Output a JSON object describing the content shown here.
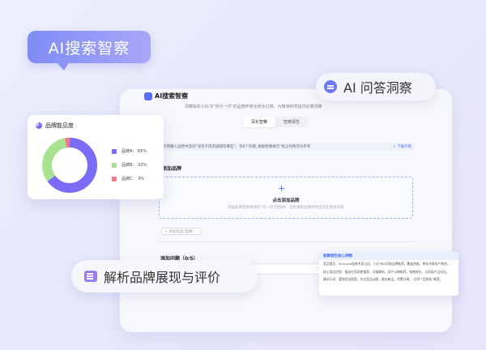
{
  "badge_title": "AI搜索智察",
  "app": {
    "title": "AI搜索智察",
    "subtitle": "洞察解析小红书\"你问一问\"的品牌声量全情全口碑，为精准种草提供前瞻洞察",
    "tabs": [
      {
        "label": "深化智察",
        "active": true
      },
      {
        "label": "智察报告",
        "active": false
      }
    ],
    "info_text": "示例输入运营中首创\"适合干皮的面霜有哪些\"，等6个问题_根据智察报告\"抢占导购作为参考",
    "info_link": "↓ 下载示例",
    "section_title": "添加品牌",
    "add_label": "点击添加品牌",
    "add_hint": "添加品牌后系统将在\"问一问\"回答中，识别搜索品牌并作出对应相关内容",
    "add_input_placeholder": "+ 添加竞品(选填)",
    "questions_title": "添加问题（0/5）"
  },
  "visibility_card": {
    "title": "品牌能见度",
    "icon": "pie-chart-icon"
  },
  "chart_data": {
    "type": "pie",
    "title": "品牌能见度",
    "categories": [
      "品牌A",
      "品牌B",
      "品牌C"
    ],
    "values": [
      65,
      32,
      3
    ],
    "labels": [
      "65%",
      "32%",
      "3%"
    ],
    "colors": [
      "#7a6cf5",
      "#a8e38f",
      "#f07a8a"
    ]
  },
  "pill_qa": {
    "label": "AI 问答洞察",
    "icon": "chat-icon"
  },
  "pill_analysis": {
    "label": "解析品牌展现与评价",
    "icon": "document-icon"
  },
  "report_card": {
    "header": "智察报告核心洞察",
    "lines": [
      "竞品提及：Skincare肌肤专家占比，小红书AI问答品牌推荐，覆盖热度，探析关联用户需求。",
      "核心竞品优势：服务在官网更推荐，详情解析，用户口碑推荐，销售转化，与同类产品对比。",
      "建议行动：重视优化搜索，关注竞品动态，推出新品，积累口碑，\"达问\"\"定制化\"推荐。"
    ]
  }
}
